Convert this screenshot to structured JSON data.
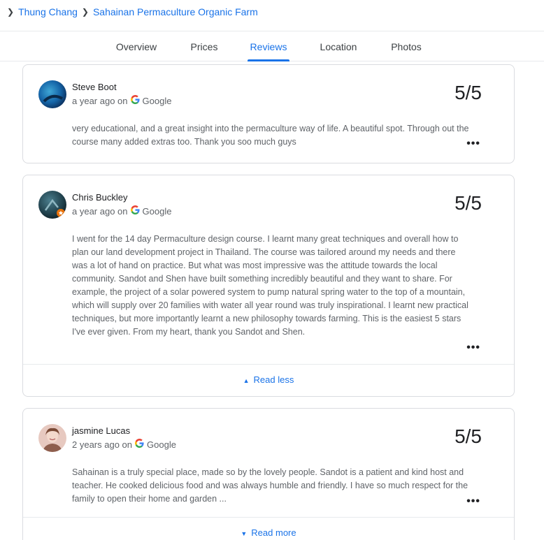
{
  "breadcrumb": {
    "items": [
      "Thung Chang",
      "Sahainan Permaculture Organic Farm"
    ]
  },
  "tabs": [
    {
      "label": "Overview",
      "active": false
    },
    {
      "label": "Prices",
      "active": false
    },
    {
      "label": "Reviews",
      "active": true
    },
    {
      "label": "Location",
      "active": false
    },
    {
      "label": "Photos",
      "active": false
    }
  ],
  "reviews": [
    {
      "author": "Steve Boot",
      "time": "a year ago on",
      "source": "Google",
      "score": "5/5",
      "text": "very educational, and a great insight into the permaculture way of life. A beautiful spot. Through out the course many added extras too. Thank you soo much guys"
    },
    {
      "author": "Chris Buckley",
      "time": "a year ago on",
      "source": "Google",
      "score": "5/5",
      "text": "I went for the 14 day Permaculture design course. I learnt many great techniques and overall how to plan our land development project in Thailand. The course was tailored around my needs and there was a lot of hand on practice. But what was most impressive was the attitude towards the local community. Sandot and Shen have built something incredibly beautiful and they want to share. For example, the project of a solar powered system to pump natural spring water to the top of a mountain, which will supply over 20 families with water all year round was truly inspirational. I learnt new practical techniques, but more importantly learnt a new philosophy towards farming. This is the easiest 5 stars I've ever given. From my heart, thank you Sandot and Shen.",
      "toggle": "Read less"
    },
    {
      "author": "jasmine Lucas",
      "time": "2 years ago on",
      "source": "Google",
      "score": "5/5",
      "text": "Sahainan is a truly special place, made so by the lovely people. Sandot is a patient and kind host and teacher. He cooked delicious food and was always humble and friendly. I have so much respect for the family to open their home and garden ...",
      "toggle": "Read more"
    }
  ],
  "icons": {
    "more": "more-horiz-icon",
    "google": "google-g-icon",
    "chevron": "chevron-right-icon"
  },
  "colors": {
    "accent": "#1a73e8",
    "text": "#202124",
    "muted": "#5f6368",
    "border": "#dadce0"
  }
}
